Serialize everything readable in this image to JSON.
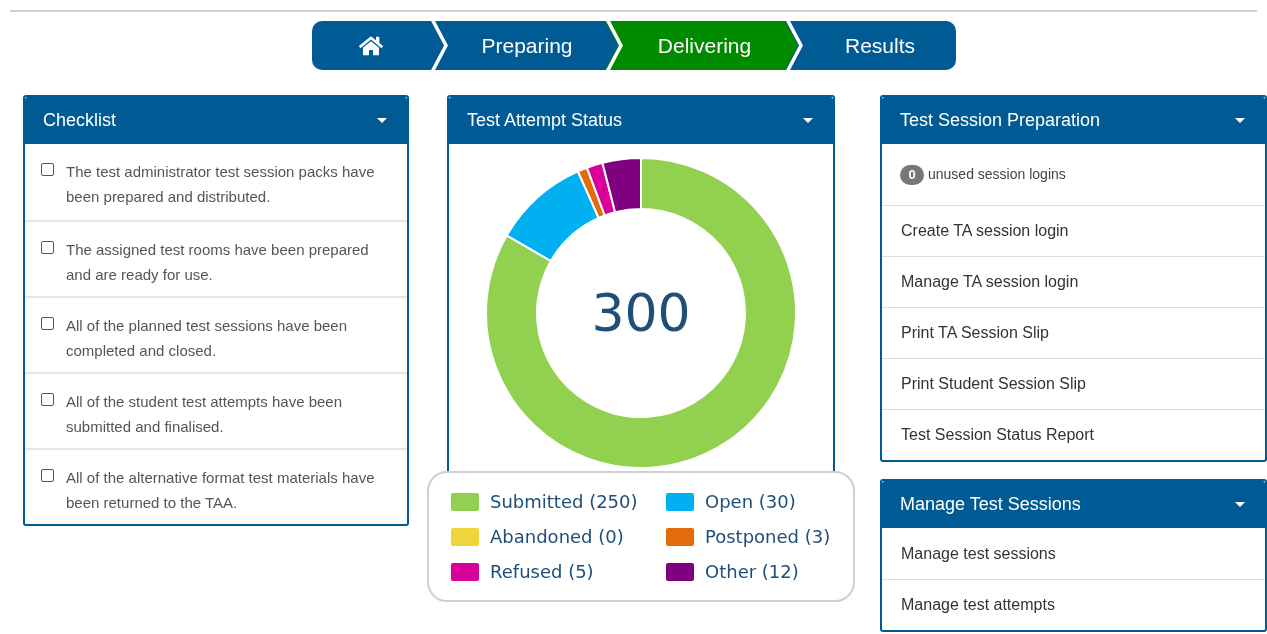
{
  "steps": [
    {
      "kind": "home",
      "selected": false
    },
    {
      "kind": "step",
      "label": "Preparing",
      "selected": false
    },
    {
      "kind": "step",
      "label": "Delivering",
      "selected": true
    },
    {
      "kind": "step",
      "label": "Results",
      "selected": false
    }
  ],
  "checklist": {
    "title": "Checklist",
    "items": [
      {
        "text": "The test administrator test session packs have been prepared and distributed.",
        "checked": false
      },
      {
        "text": "The assigned test rooms have been prepared and are ready for use.",
        "checked": false
      },
      {
        "text": "All of the planned test sessions have been completed and closed.",
        "checked": false
      },
      {
        "text": "All of the student test attempts have been submitted and finalised.",
        "checked": false
      },
      {
        "text": "All of the alternative format test materials have been returned to the TAA.",
        "checked": false
      }
    ]
  },
  "status": {
    "title": "Test Attempt Status",
    "total": "300",
    "chart_data": {
      "type": "donut",
      "categories": [
        "Submitted (250)",
        "Open (30)",
        "Abandoned (0)",
        "Postponed (3)",
        "Refused (5)",
        "Other (12)"
      ],
      "values": [
        250,
        30,
        0,
        3,
        5,
        12
      ]
    },
    "legend": [
      {
        "color": "#92d050"
      },
      {
        "color": "#00b0f0"
      },
      {
        "color": "#f0d43c"
      },
      {
        "color": "#e36c0a"
      },
      {
        "color": "#d9009a"
      },
      {
        "color": "#7f007f"
      }
    ]
  },
  "preparation": {
    "title": "Test Session Preparation",
    "badge": "0",
    "badge_text": "unused session logins",
    "links": [
      "Create TA session login",
      "Manage TA session login",
      "Print TA Session Slip",
      "Print Student Session Slip",
      "Test Session Status Report"
    ]
  },
  "manage": {
    "title": "Manage Test Sessions",
    "links": [
      "Manage test sessions",
      "Manage test attempts"
    ]
  }
}
